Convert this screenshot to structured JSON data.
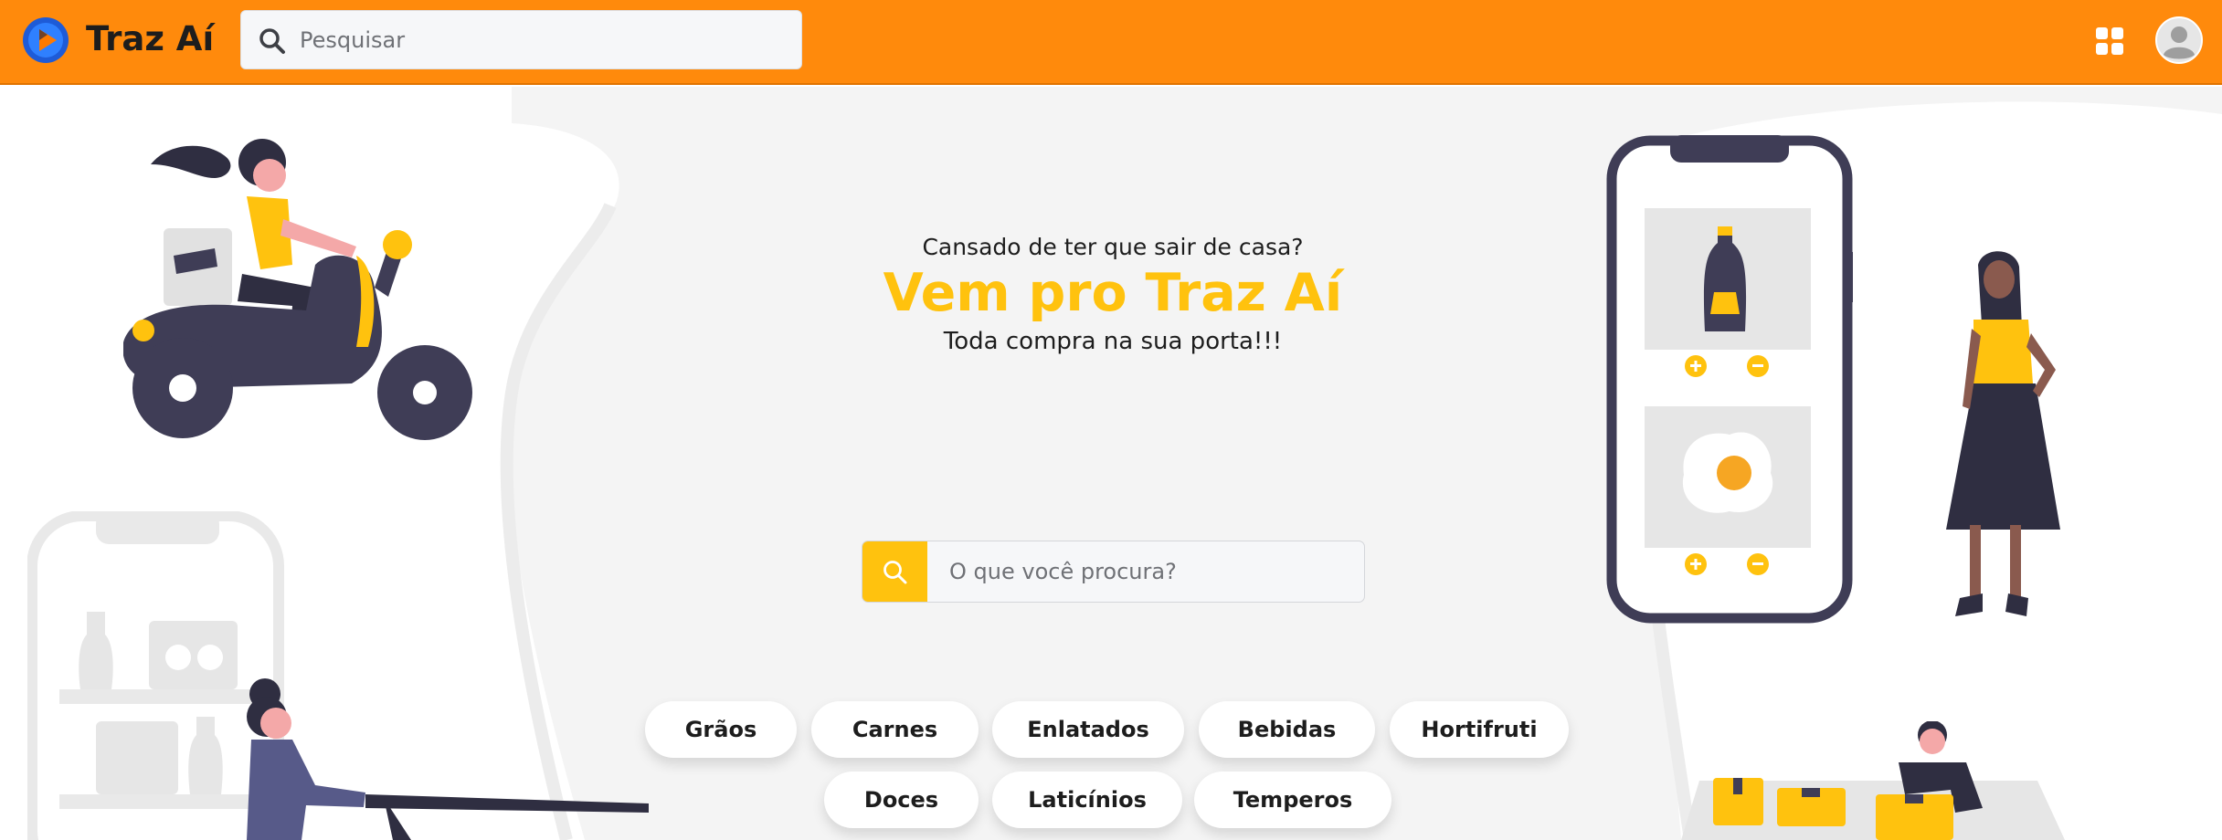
{
  "header": {
    "brand": "Traz Aí",
    "search_placeholder": "Pesquisar",
    "icons": [
      "logo-play-icon",
      "search-icon",
      "apps-grid-icon",
      "user-avatar-icon"
    ]
  },
  "hero": {
    "question": "Cansado de ter que sair de casa?",
    "title": "Vem pro Traz Aí",
    "tagline": "Toda compra na sua porta!!!",
    "search_placeholder": "O que você procura?"
  },
  "categories": {
    "row1": [
      "Grãos",
      "Carnes",
      "Enlatados",
      "Bebidas",
      "Hortifruti"
    ],
    "row2": [
      "Doces",
      "Laticínios",
      "Temperos"
    ]
  },
  "colors": {
    "header_bg": "#ff8a0c",
    "accent_yellow": "#ffc20e",
    "dark_illustration": "#3f3d56"
  }
}
